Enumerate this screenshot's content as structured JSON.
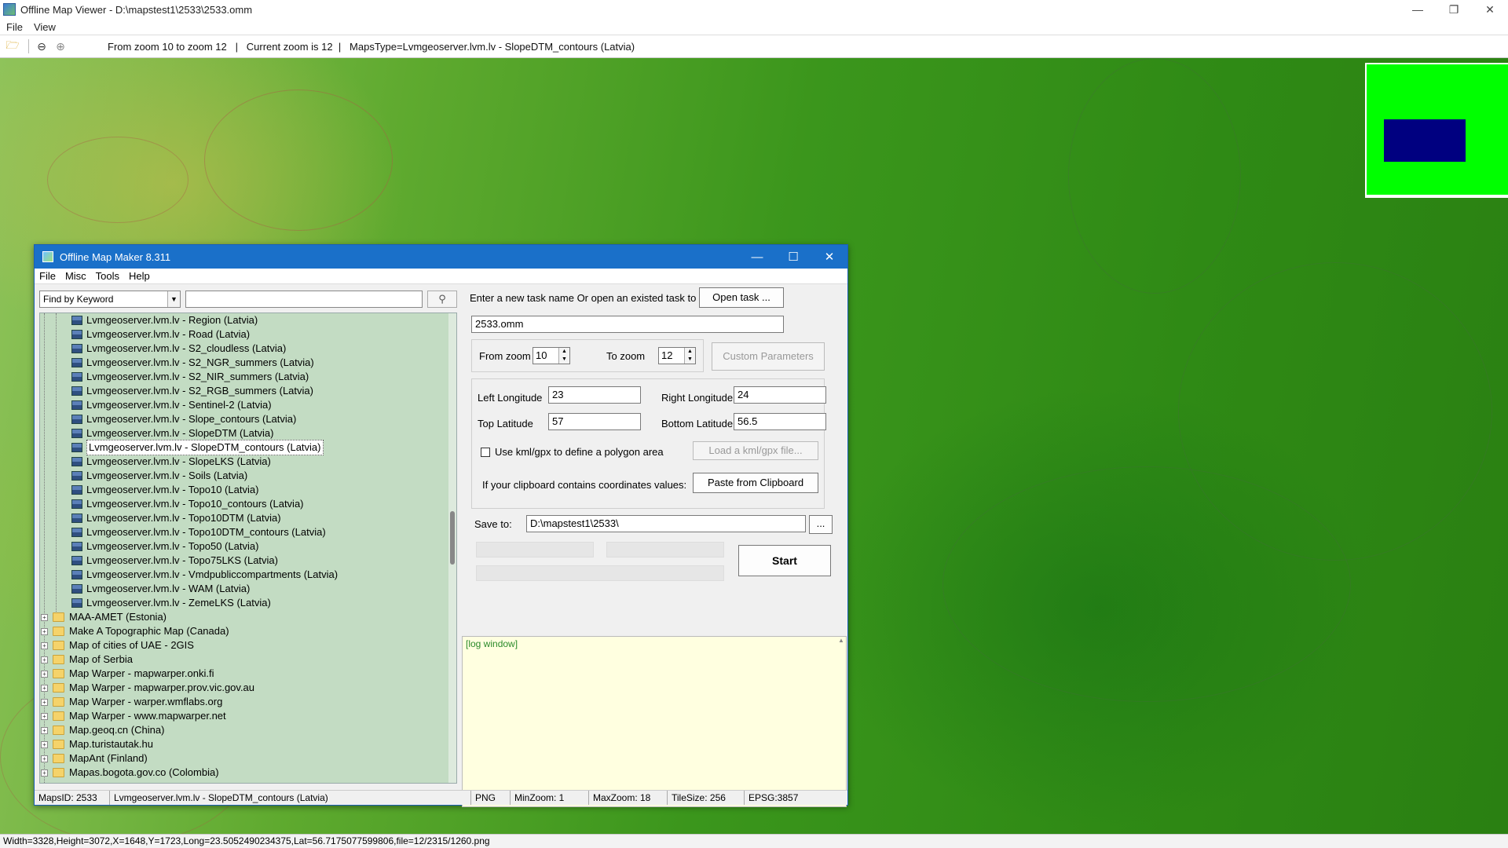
{
  "viewer": {
    "title": "Offline Map Viewer - D:\\mapstest1\\2533\\2533.omm",
    "menu": [
      "File",
      "View"
    ],
    "toolbar_info": "From zoom 10 to zoom 12   |   Current zoom is 12  |   MapsType=Lvmgeoserver.lvm.lv - SlopeDTM_contours (Latvia)",
    "status": "Width=3328,Height=3072,X=1648,Y=1723,Long=23.5052490234375,Lat=56.7175077599806,file=12/2315/1260.png"
  },
  "dialog": {
    "title": "Offline Map Maker 8.311",
    "menu": [
      "File",
      "Misc",
      "Tools",
      "Help"
    ],
    "search": {
      "mode": "Find by Keyword",
      "keyword": ""
    },
    "tree": {
      "children": [
        "Lvmgeoserver.lvm.lv - Region (Latvia)",
        "Lvmgeoserver.lvm.lv - Road (Latvia)",
        "Lvmgeoserver.lvm.lv - S2_cloudless (Latvia)",
        "Lvmgeoserver.lvm.lv - S2_NGR_summers (Latvia)",
        "Lvmgeoserver.lvm.lv - S2_NIR_summers (Latvia)",
        "Lvmgeoserver.lvm.lv - S2_RGB_summers (Latvia)",
        "Lvmgeoserver.lvm.lv - Sentinel-2 (Latvia)",
        "Lvmgeoserver.lvm.lv - Slope_contours (Latvia)",
        "Lvmgeoserver.lvm.lv - SlopeDTM (Latvia)",
        "Lvmgeoserver.lvm.lv - SlopeDTM_contours (Latvia)",
        "Lvmgeoserver.lvm.lv - SlopeLKS (Latvia)",
        "Lvmgeoserver.lvm.lv - Soils (Latvia)",
        "Lvmgeoserver.lvm.lv - Topo10 (Latvia)",
        "Lvmgeoserver.lvm.lv - Topo10_contours (Latvia)",
        "Lvmgeoserver.lvm.lv - Topo10DTM (Latvia)",
        "Lvmgeoserver.lvm.lv - Topo10DTM_contours (Latvia)",
        "Lvmgeoserver.lvm.lv - Topo50 (Latvia)",
        "Lvmgeoserver.lvm.lv - Topo75LKS (Latvia)",
        "Lvmgeoserver.lvm.lv - Vmdpubliccompartments (Latvia)",
        "Lvmgeoserver.lvm.lv - WAM (Latvia)",
        "Lvmgeoserver.lvm.lv - ZemeLKS (Latvia)"
      ],
      "selected": "Lvmgeoserver.lvm.lv - SlopeDTM_contours (Latvia)",
      "folders": [
        "MAA-AMET (Estonia)",
        "Make A Topographic Map (Canada)",
        "Map of cities of UAE - 2GIS",
        "Map of Serbia",
        "Map Warper - mapwarper.onki.fi",
        "Map Warper - mapwarper.prov.vic.gov.au",
        "Map Warper - warper.wmflabs.org",
        "Map Warper - www.mapwarper.net",
        "Map.geoq.cn (China)",
        "Map.turistautak.hu",
        "MapAnt (Finland)",
        "Mapas.bogota.gov.co (Colombia)"
      ]
    },
    "task": {
      "prompt": "Enter a new task name Or open an existed task to continue:",
      "open_label": "Open task ...",
      "name": "2533.omm"
    },
    "zoom": {
      "from_label": "From zoom",
      "from": "10",
      "to_label": "To zoom",
      "to": "12",
      "custom_label": "Custom Parameters"
    },
    "coords": {
      "left_label": "Left Longitude",
      "left": "23",
      "right_label": "Right Longitude",
      "right": "24",
      "top_label": "Top Latitude",
      "top": "57",
      "bottom_label": "Bottom Latitude",
      "bottom": "56.5",
      "kml_label": "Use kml/gpx to define a polygon area",
      "kml_button": "Load a kml/gpx file...",
      "clipboard_label": "If your clipboard contains coordinates values:",
      "clipboard_button": "Paste from Clipboard"
    },
    "save": {
      "label": "Save to:",
      "path": "D:\\mapstest1\\2533\\",
      "browse": "...",
      "start": "Start"
    },
    "log": "[log window]",
    "status": {
      "maps_id": "MapsID: 2533",
      "maps_name": "Lvmgeoserver.lvm.lv - SlopeDTM_contours (Latvia)",
      "format": "PNG",
      "min_zoom": "MinZoom: 1",
      "max_zoom": "MaxZoom: 18",
      "tile_size": "TileSize: 256",
      "epsg": "EPSG:3857"
    }
  }
}
